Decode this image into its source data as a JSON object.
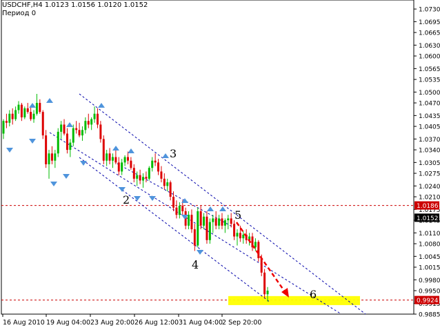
{
  "header": {
    "symbol_line": "USDCHF,H4  1.0123 1.0156 1.0120 1.0152",
    "period_line": "Период  0"
  },
  "chart_data": {
    "type": "candlestick",
    "title": "",
    "symbol": "USDCHF",
    "timeframe": "H4",
    "ohlc_last": {
      "open": 1.0123,
      "high": 1.0156,
      "low": 1.012,
      "close": 1.0152
    },
    "ylim": [
      0.9885,
      1.0755
    ],
    "y_ticks": [
      "1.0730",
      "1.0695",
      "1.0665",
      "1.0630",
      "1.0600",
      "1.0565",
      "1.0535",
      "1.0500",
      "1.0470",
      "1.0435",
      "1.0405",
      "1.0370",
      "1.0340",
      "1.0305",
      "1.0275",
      "1.0240",
      "1.0210",
      "1.0175",
      "1.0145",
      "1.0110",
      "1.0080",
      "1.0045",
      "1.0015",
      "0.9980",
      "0.9950",
      "0.9915",
      "0.9885"
    ],
    "x_ticks": [
      "16 Aug 2010",
      "19 Aug 04:00",
      "23 Aug 20:00",
      "26 Aug 12:00",
      "31 Aug 04:00",
      "2 Sep 20:00"
    ],
    "price_labels": [
      {
        "value": "1.0186",
        "color": "#cc0000",
        "text_color": "#ffffff"
      },
      {
        "value": "1.0152",
        "color": "#000000",
        "text_color": "#ffffff"
      },
      {
        "value": "0.9924",
        "color": "#cc0000",
        "text_color": "#ffffff"
      }
    ],
    "horizontal_lines": [
      {
        "price": 1.0186,
        "color": "#cc0000",
        "style": "dashed"
      },
      {
        "price": 0.9924,
        "color": "#cc0000",
        "style": "dashed"
      }
    ],
    "wave_labels": [
      "2",
      "3",
      "4",
      "5",
      "6"
    ],
    "target_zone": {
      "price_low": 0.991,
      "price_high": 0.9935,
      "color": "#ffff00"
    },
    "colors": {
      "bull": "#00bb00",
      "bear": "#dd0000",
      "fractal": "#4f94dc",
      "channel": "#0000aa",
      "arrow": "#ee0000"
    },
    "candles": [
      [
        1.0385,
        1.0425,
        1.037,
        1.042
      ],
      [
        1.042,
        1.044,
        1.04,
        1.0415
      ],
      [
        1.0415,
        1.045,
        1.0405,
        1.044
      ],
      [
        1.044,
        1.0455,
        1.041,
        1.0425
      ],
      [
        1.0425,
        1.046,
        1.042,
        1.045
      ],
      [
        1.045,
        1.0475,
        1.044,
        1.0465
      ],
      [
        1.0465,
        1.047,
        1.042,
        1.043
      ],
      [
        1.043,
        1.046,
        1.0425,
        1.0455
      ],
      [
        1.0455,
        1.047,
        1.044,
        1.0445
      ],
      [
        1.0445,
        1.046,
        1.042,
        1.0425
      ],
      [
        1.0425,
        1.045,
        1.0415,
        1.044
      ],
      [
        1.044,
        1.0495,
        1.0435,
        1.047
      ],
      [
        1.047,
        1.048,
        1.044,
        1.0445
      ],
      [
        1.0445,
        1.045,
        1.037,
        1.038
      ],
      [
        1.038,
        1.0395,
        1.029,
        1.03
      ],
      [
        1.03,
        1.034,
        1.026,
        1.033
      ],
      [
        1.033,
        1.035,
        1.03,
        1.031
      ],
      [
        1.031,
        1.034,
        1.029,
        1.033
      ],
      [
        1.033,
        1.04,
        1.032,
        1.039
      ],
      [
        1.039,
        1.042,
        1.037,
        1.041
      ],
      [
        1.041,
        1.0425,
        1.038,
        1.0385
      ],
      [
        1.0385,
        1.04,
        1.033,
        1.034
      ],
      [
        1.034,
        1.037,
        1.032,
        1.036
      ],
      [
        1.036,
        1.041,
        1.035,
        1.04
      ],
      [
        1.04,
        1.042,
        1.0385,
        1.0395
      ],
      [
        1.0395,
        1.0415,
        1.0375,
        1.038
      ],
      [
        1.038,
        1.0405,
        1.0365,
        1.0395
      ],
      [
        1.0395,
        1.043,
        1.0385,
        1.042
      ],
      [
        1.042,
        1.044,
        1.04,
        1.041
      ],
      [
        1.041,
        1.043,
        1.0395,
        1.0425
      ],
      [
        1.0425,
        1.046,
        1.0415,
        1.044
      ],
      [
        1.044,
        1.0455,
        1.04,
        1.041
      ],
      [
        1.041,
        1.042,
        1.036,
        1.037
      ],
      [
        1.037,
        1.038,
        1.03,
        1.031
      ],
      [
        1.031,
        1.034,
        1.0295,
        1.033
      ],
      [
        1.033,
        1.0345,
        1.03,
        1.031
      ],
      [
        1.031,
        1.033,
        1.029,
        1.032
      ],
      [
        1.032,
        1.034,
        1.03,
        1.0305
      ],
      [
        1.0305,
        1.032,
        1.027,
        1.028
      ],
      [
        1.028,
        1.0315,
        1.027,
        1.0305
      ],
      [
        1.0305,
        1.0325,
        1.0295,
        1.032
      ],
      [
        1.032,
        1.0335,
        1.03,
        1.031
      ],
      [
        1.031,
        1.032,
        1.0285,
        1.029
      ],
      [
        1.029,
        1.03,
        1.025,
        1.026
      ],
      [
        1.026,
        1.028,
        1.024,
        1.027
      ],
      [
        1.027,
        1.0285,
        1.0245,
        1.0255
      ],
      [
        1.0255,
        1.0275,
        1.0235,
        1.0265
      ],
      [
        1.0265,
        1.028,
        1.025,
        1.026
      ],
      [
        1.026,
        1.0295,
        1.0255,
        1.029
      ],
      [
        1.029,
        1.032,
        1.028,
        1.031
      ],
      [
        1.031,
        1.033,
        1.0295,
        1.0305
      ],
      [
        1.0305,
        1.0315,
        1.027,
        1.028
      ],
      [
        1.028,
        1.0295,
        1.025,
        1.026
      ],
      [
        1.026,
        1.0275,
        1.023,
        1.024
      ],
      [
        1.024,
        1.026,
        1.0225,
        1.025
      ],
      [
        1.025,
        1.0255,
        1.02,
        1.021
      ],
      [
        1.021,
        1.0225,
        1.017,
        1.018
      ],
      [
        1.018,
        1.02,
        1.015,
        1.016
      ],
      [
        1.016,
        1.0195,
        1.015,
        1.0185
      ],
      [
        1.0185,
        1.02,
        1.016,
        1.017
      ],
      [
        1.017,
        1.018,
        1.012,
        1.013
      ],
      [
        1.013,
        1.017,
        1.012,
        1.016
      ],
      [
        1.016,
        1.0175,
        1.011,
        1.012
      ],
      [
        1.012,
        1.0135,
        1.006,
        1.0075
      ],
      [
        1.0075,
        1.018,
        1.007,
        1.017
      ],
      [
        1.017,
        1.0185,
        1.012,
        1.013
      ],
      [
        1.013,
        1.0165,
        1.012,
        1.0155
      ],
      [
        1.0155,
        1.017,
        1.008,
        1.009
      ],
      [
        1.009,
        1.015,
        1.008,
        1.014
      ],
      [
        1.014,
        1.016,
        1.011,
        1.015
      ],
      [
        1.015,
        1.017,
        1.012,
        1.013
      ],
      [
        1.013,
        1.016,
        1.012,
        1.015
      ],
      [
        1.015,
        1.0165,
        1.012,
        1.013
      ],
      [
        1.013,
        1.015,
        1.011,
        1.0145
      ],
      [
        1.0145,
        1.016,
        1.012,
        1.015
      ],
      [
        1.015,
        1.0165,
        1.0125,
        1.0135
      ],
      [
        1.0135,
        1.0145,
        1.009,
        1.01
      ],
      [
        1.01,
        1.012,
        1.0075,
        1.011
      ],
      [
        1.011,
        1.013,
        1.0085,
        1.0095
      ],
      [
        1.0095,
        1.0115,
        1.008,
        1.0105
      ],
      [
        1.0105,
        1.012,
        1.008,
        1.009
      ],
      [
        1.009,
        1.011,
        1.0075,
        1.01
      ],
      [
        1.01,
        1.011,
        1.006,
        1.007
      ],
      [
        1.007,
        1.0095,
        1.006,
        1.0085
      ],
      [
        1.0085,
        1.009,
        1.003,
        1.004
      ],
      [
        1.004,
        1.005,
        0.999,
        1.0
      ],
      [
        1.0,
        1.001,
        0.993,
        0.994
      ],
      [
        0.994,
        0.996,
        0.992,
        0.995
      ]
    ]
  }
}
